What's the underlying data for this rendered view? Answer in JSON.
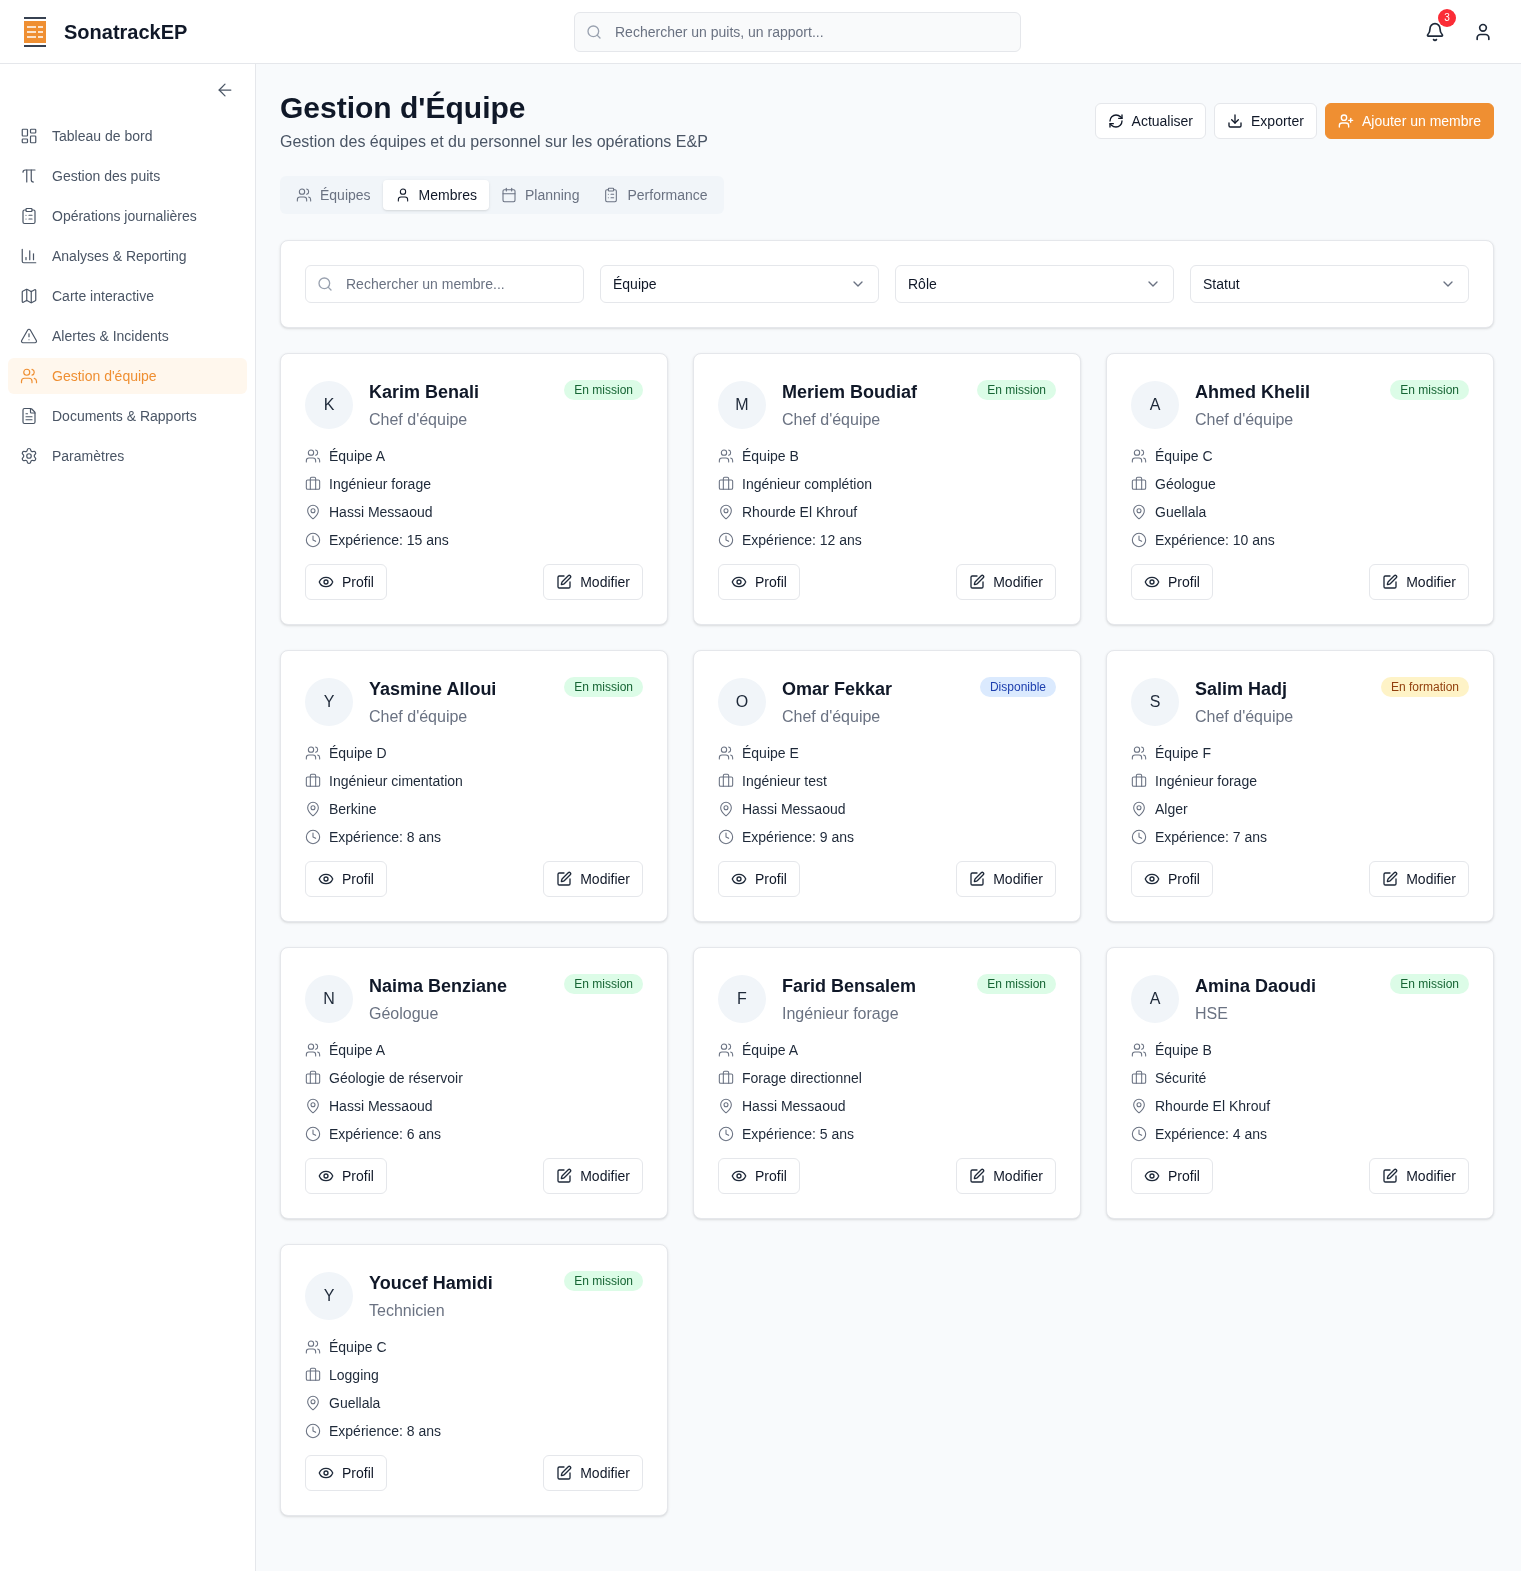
{
  "header": {
    "app_title": "SonatrackEP",
    "search": {
      "placeholder": "Rechercher un puits, un rapport..."
    },
    "notifications": {
      "count": "3"
    }
  },
  "sidebar": {
    "items": [
      {
        "label": "Tableau de bord",
        "selected": false
      },
      {
        "label": "Gestion des puits",
        "selected": false
      },
      {
        "label": "Opérations journalières",
        "selected": false
      },
      {
        "label": "Analyses & Reporting",
        "selected": false
      },
      {
        "label": "Carte interactive",
        "selected": false
      },
      {
        "label": "Alertes & Incidents",
        "selected": false
      },
      {
        "label": "Gestion d'équipe",
        "selected": true
      },
      {
        "label": "Documents & Rapports",
        "selected": false
      },
      {
        "label": "Paramètres",
        "selected": false
      }
    ]
  },
  "page": {
    "title": "Gestion d'Équipe",
    "subtitle": "Gestion des équipes et du personnel sur les opérations E&P",
    "actions": [
      {
        "label": "Actualiser",
        "kind": "outline"
      },
      {
        "label": "Exporter",
        "kind": "outline"
      },
      {
        "label": "Ajouter un membre",
        "kind": "primary"
      }
    ]
  },
  "tabs": [
    {
      "label": "Équipes",
      "selected": false
    },
    {
      "label": "Membres",
      "selected": true
    },
    {
      "label": "Planning",
      "selected": false
    },
    {
      "label": "Performance",
      "selected": false
    }
  ],
  "filters": {
    "search": {
      "placeholder": "Rechercher un membre..."
    },
    "selects": [
      {
        "value": "Équipe"
      },
      {
        "value": "Rôle"
      },
      {
        "value": "Statut"
      }
    ]
  },
  "members": [
    {
      "initial": "K",
      "name": "Karim Benali",
      "role": "Chef d'équipe",
      "status": {
        "label": "En mission",
        "color": "#dcfce7"
      },
      "team": "Équipe A",
      "position": "Ingénieur forage",
      "location": "Hassi Messaoud",
      "experience": "Expérience: 15 ans",
      "actions": [
        "Profil",
        "Modifier"
      ]
    },
    {
      "initial": "M",
      "name": "Meriem Boudiaf",
      "role": "Chef d'équipe",
      "status": {
        "label": "En mission",
        "color": "#dcfce7"
      },
      "team": "Équipe B",
      "position": "Ingénieur complétion",
      "location": "Rhourde El Khrouf",
      "experience": "Expérience: 12 ans",
      "actions": [
        "Profil",
        "Modifier"
      ]
    },
    {
      "initial": "A",
      "name": "Ahmed Khelil",
      "role": "Chef d'équipe",
      "status": {
        "label": "En mission",
        "color": "#dcfce7"
      },
      "team": "Équipe C",
      "position": "Géologue",
      "location": "Guellala",
      "experience": "Expérience: 10 ans",
      "actions": [
        "Profil",
        "Modifier"
      ]
    },
    {
      "initial": "Y",
      "name": "Yasmine Alloui",
      "role": "Chef d'équipe",
      "status": {
        "label": "En mission",
        "color": "#dcfce7"
      },
      "team": "Équipe D",
      "position": "Ingénieur cimentation",
      "location": "Berkine",
      "experience": "Expérience: 8 ans",
      "actions": [
        "Profil",
        "Modifier"
      ]
    },
    {
      "initial": "O",
      "name": "Omar Fekkar",
      "role": "Chef d'équipe",
      "status": {
        "label": "Disponible",
        "color": "#dbeafe"
      },
      "team": "Équipe E",
      "position": "Ingénieur test",
      "location": "Hassi Messaoud",
      "experience": "Expérience: 9 ans",
      "actions": [
        "Profil",
        "Modifier"
      ]
    },
    {
      "initial": "S",
      "name": "Salim Hadj",
      "role": "Chef d'équipe",
      "status": {
        "label": "En formation",
        "color": "#fef3c7"
      },
      "team": "Équipe F",
      "position": "Ingénieur forage",
      "location": "Alger",
      "experience": "Expérience: 7 ans",
      "actions": [
        "Profil",
        "Modifier"
      ]
    },
    {
      "initial": "N",
      "name": "Naima Benziane",
      "role": "Géologue",
      "status": {
        "label": "En mission",
        "color": "#dcfce7"
      },
      "team": "Équipe A",
      "position": "Géologie de réservoir",
      "location": "Hassi Messaoud",
      "experience": "Expérience: 6 ans",
      "actions": [
        "Profil",
        "Modifier"
      ]
    },
    {
      "initial": "F",
      "name": "Farid Bensalem",
      "role": "Ingénieur forage",
      "status": {
        "label": "En mission",
        "color": "#dcfce7"
      },
      "team": "Équipe A",
      "position": "Forage directionnel",
      "location": "Hassi Messaoud",
      "experience": "Expérience: 5 ans",
      "actions": [
        "Profil",
        "Modifier"
      ]
    },
    {
      "initial": "A",
      "name": "Amina Daoudi",
      "role": "HSE",
      "status": {
        "label": "En mission",
        "color": "#dcfce7"
      },
      "team": "Équipe B",
      "position": "Sécurité",
      "location": "Rhourde El Khrouf",
      "experience": "Expérience: 4 ans",
      "actions": [
        "Profil",
        "Modifier"
      ]
    },
    {
      "initial": "Y",
      "name": "Youcef Hamidi",
      "role": "Technicien",
      "status": {
        "label": "En mission",
        "color": "#dcfce7"
      },
      "team": "Équipe C",
      "position": "Logging",
      "location": "Guellala",
      "experience": "Expérience: 8 ans",
      "actions": [
        "Profil",
        "Modifier"
      ]
    }
  ]
}
